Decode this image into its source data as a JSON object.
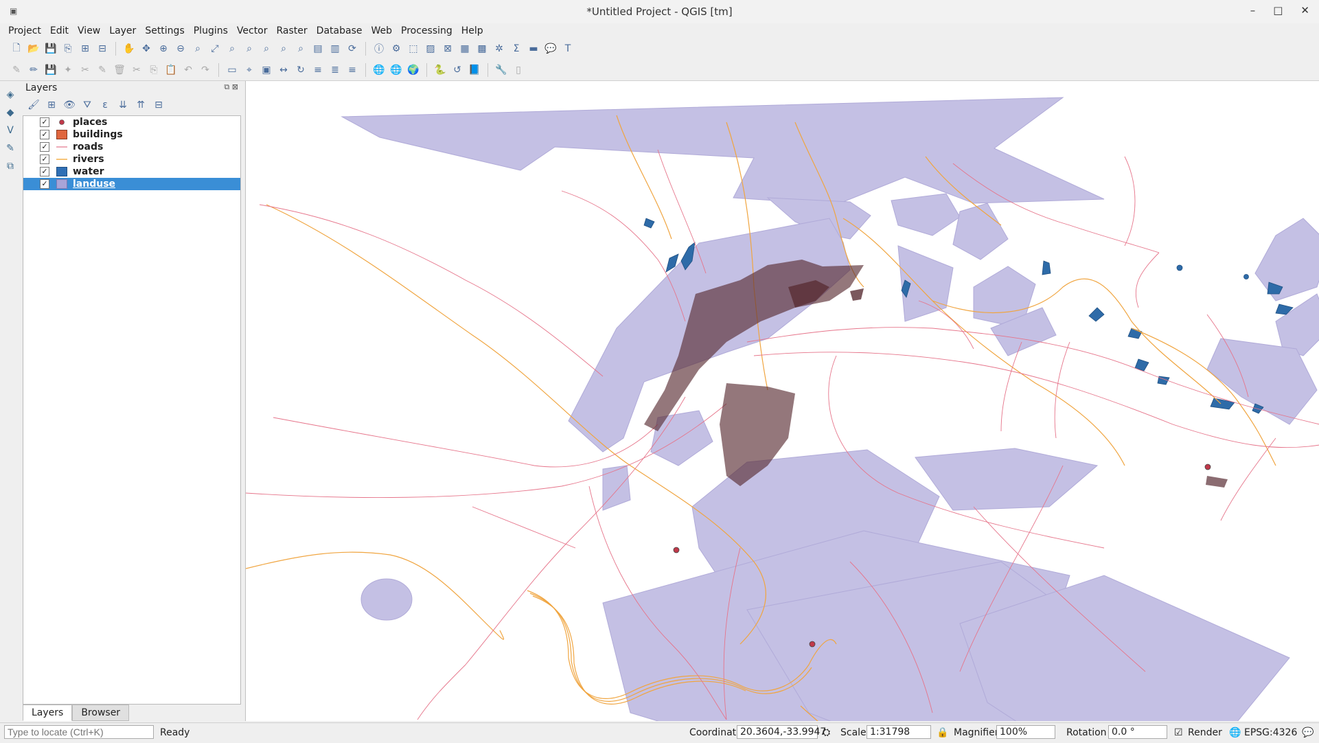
{
  "window": {
    "title": "*Untitled Project - QGIS [tm]"
  },
  "menu": [
    "Project",
    "Edit",
    "View",
    "Layer",
    "Settings",
    "Plugins",
    "Vector",
    "Raster",
    "Database",
    "Web",
    "Processing",
    "Help"
  ],
  "layers_panel": {
    "title": "Layers",
    "layers": [
      {
        "name": "places",
        "checked": true,
        "symbol": "point",
        "color": "#c0394a"
      },
      {
        "name": "buildings",
        "checked": true,
        "symbol": "fill",
        "color": "#e0663e"
      },
      {
        "name": "roads",
        "checked": true,
        "symbol": "line",
        "color": "#e88fa0"
      },
      {
        "name": "rivers",
        "checked": true,
        "symbol": "line",
        "color": "#f2b14a"
      },
      {
        "name": "water",
        "checked": true,
        "symbol": "fill",
        "color": "#2f6fb5"
      },
      {
        "name": "landuse",
        "checked": true,
        "symbol": "fill",
        "color": "#a8a4d8",
        "selected": true
      }
    ],
    "tabs": [
      "Layers",
      "Browser"
    ]
  },
  "map": {
    "landuse_color": "#c4c0e4",
    "road_color": "#e6748a",
    "river_color": "#f0a540",
    "water_color": "#2e6ba8",
    "building_color": "#5a2e34"
  },
  "status": {
    "locate_placeholder": "Type to locate (Ctrl+K)",
    "message": "Ready",
    "coordinate_label": "Coordinate",
    "coordinate_value": "20.3604,-33.9947",
    "scale_label": "Scale",
    "scale_value": "1:31798",
    "magnifier_label": "Magnifier",
    "magnifier_value": "100%",
    "rotation_label": "Rotation",
    "rotation_value": "0.0 °",
    "render_label": "Render",
    "crs": "EPSG:4326"
  }
}
